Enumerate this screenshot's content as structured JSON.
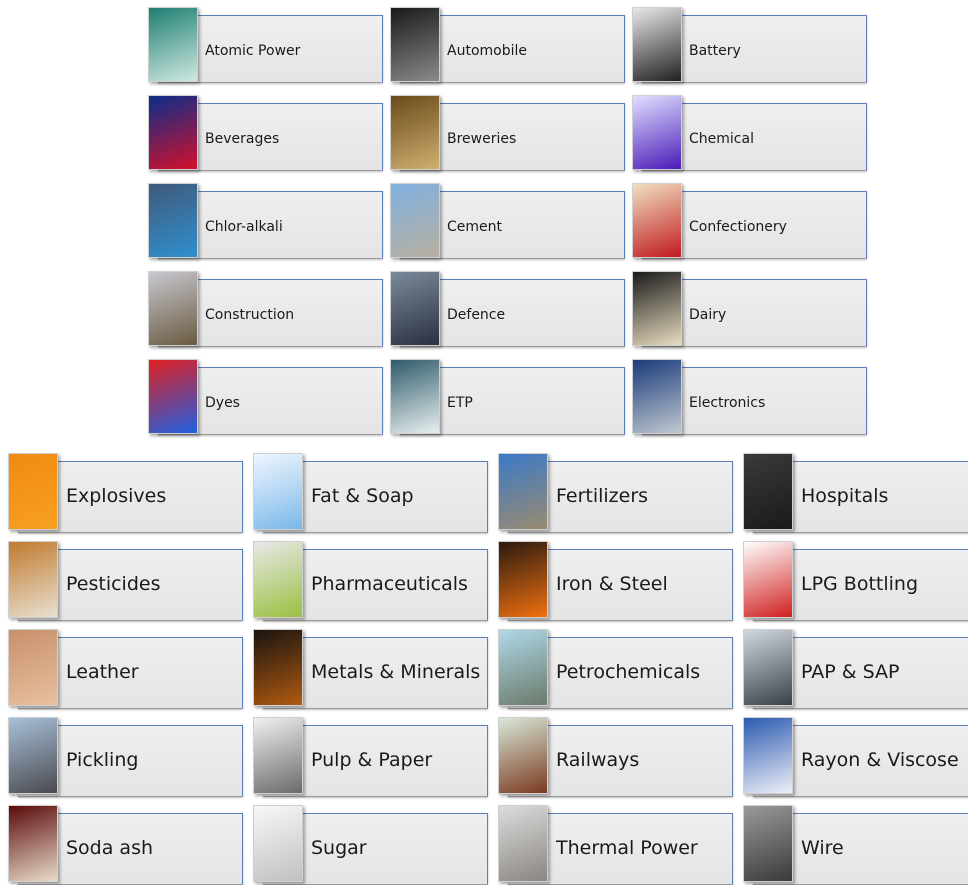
{
  "top_grid": [
    {
      "label": "Atomic Power",
      "icon": "atomic-power-photo-icon",
      "c1": "#1f7f72",
      "c2": "#cfe8e0"
    },
    {
      "label": "Automobile",
      "icon": "automobile-photo-icon",
      "c1": "#1a1a1a",
      "c2": "#8a8a8a"
    },
    {
      "label": "Battery",
      "icon": "battery-photo-icon",
      "c1": "#e8e8e8",
      "c2": "#202020"
    },
    {
      "label": "Beverages",
      "icon": "beverages-photo-icon",
      "c1": "#0b2e8a",
      "c2": "#d3102a"
    },
    {
      "label": "Breweries",
      "icon": "breweries-photo-icon",
      "c1": "#6a4a1a",
      "c2": "#d0b070"
    },
    {
      "label": "Chemical",
      "icon": "chemical-photo-icon",
      "c1": "#e0e0ff",
      "c2": "#4a1ab8"
    },
    {
      "label": "Chlor-alkali",
      "icon": "chlor-alkali-photo-icon",
      "c1": "#405a7a",
      "c2": "#2f8fd0"
    },
    {
      "label": "Cement",
      "icon": "cement-photo-icon",
      "c1": "#7fb0e0",
      "c2": "#b8b0a0"
    },
    {
      "label": "Confectionery",
      "icon": "confectionery-photo-icon",
      "c1": "#f0e0c0",
      "c2": "#c01a20"
    },
    {
      "label": "Construction",
      "icon": "construction-photo-icon",
      "c1": "#c8c8d0",
      "c2": "#6a5a40"
    },
    {
      "label": "Defence",
      "icon": "defence-photo-icon",
      "c1": "#7a8a9a",
      "c2": "#2a3040"
    },
    {
      "label": "Dairy",
      "icon": "dairy-photo-icon",
      "c1": "#1a1a1a",
      "c2": "#e8dcc0"
    },
    {
      "label": "Dyes",
      "icon": "dyes-photo-icon",
      "c1": "#e02020",
      "c2": "#2060e0"
    },
    {
      "label": "ETP",
      "icon": "etp-photo-icon",
      "c1": "#2f5a6a",
      "c2": "#e8f0f0"
    },
    {
      "label": "Electronics",
      "icon": "electronics-photo-icon",
      "c1": "#1a3a7a",
      "c2": "#c0c8d0"
    }
  ],
  "bottom_grid": [
    {
      "label": "Explosives",
      "icon": "explosives-sign-icon",
      "c1": "#f08a10",
      "c2": "#f8a020"
    },
    {
      "label": "Fat & Soap",
      "icon": "fat-soap-photo-icon",
      "c1": "#f0f6ff",
      "c2": "#7ab8e8"
    },
    {
      "label": "Fertilizers",
      "icon": "fertilizers-photo-icon",
      "c1": "#3a7ac8",
      "c2": "#9a8a70"
    },
    {
      "label": "Hospitals",
      "icon": "hospitals-sign-icon",
      "c1": "#3a3a3a",
      "c2": "#1a1a1a"
    },
    {
      "label": "Pesticides",
      "icon": "pesticides-photo-icon",
      "c1": "#c07a30",
      "c2": "#e8e0d0"
    },
    {
      "label": "Pharmaceuticals",
      "icon": "pharmaceuticals-photo-icon",
      "c1": "#e8e8e8",
      "c2": "#9ac040"
    },
    {
      "label": "Iron & Steel",
      "icon": "iron-steel-photo-icon",
      "c1": "#2a1a10",
      "c2": "#f07010"
    },
    {
      "label": "LPG Bottling",
      "icon": "lpg-cylinder-icon",
      "c1": "#ffffff",
      "c2": "#d02020"
    },
    {
      "label": "Leather",
      "icon": "leather-photo-icon",
      "c1": "#c8906a",
      "c2": "#e8c0a0"
    },
    {
      "label": "Metals & Minerals",
      "icon": "metals-minerals-photo-icon",
      "c1": "#1a1410",
      "c2": "#b05a10"
    },
    {
      "label": "Petrochemicals",
      "icon": "petrochemicals-photo-icon",
      "c1": "#b0d8e8",
      "c2": "#6a7a6a"
    },
    {
      "label": "PAP & SAP",
      "icon": "pap-sap-photo-icon",
      "c1": "#d0d8e0",
      "c2": "#3a4048"
    },
    {
      "label": "Pickling",
      "icon": "pickling-photo-icon",
      "c1": "#a8c0d8",
      "c2": "#4a4a50"
    },
    {
      "label": "Pulp & Paper",
      "icon": "pulp-paper-photo-icon",
      "c1": "#f0f0f0",
      "c2": "#6a6a6a"
    },
    {
      "label": "Railways",
      "icon": "railways-photo-icon",
      "c1": "#d8e8d8",
      "c2": "#7a3a20"
    },
    {
      "label": "Rayon & Viscose",
      "icon": "rayon-viscose-photo-icon",
      "c1": "#2a5ab0",
      "c2": "#f0f0f8"
    },
    {
      "label": "Soda ash",
      "icon": "soda-ash-photo-icon",
      "c1": "#5a0a0a",
      "c2": "#e8dcc8"
    },
    {
      "label": "Sugar",
      "icon": "sugar-photo-icon",
      "c1": "#f8f8f8",
      "c2": "#c0c0c0"
    },
    {
      "label": "Thermal Power",
      "icon": "thermal-power-photo-icon",
      "c1": "#dcdcdc",
      "c2": "#8a8680"
    },
    {
      "label": "Wire",
      "icon": "wire-photo-icon",
      "c1": "#9a9a9a",
      "c2": "#3a3a3a"
    }
  ]
}
